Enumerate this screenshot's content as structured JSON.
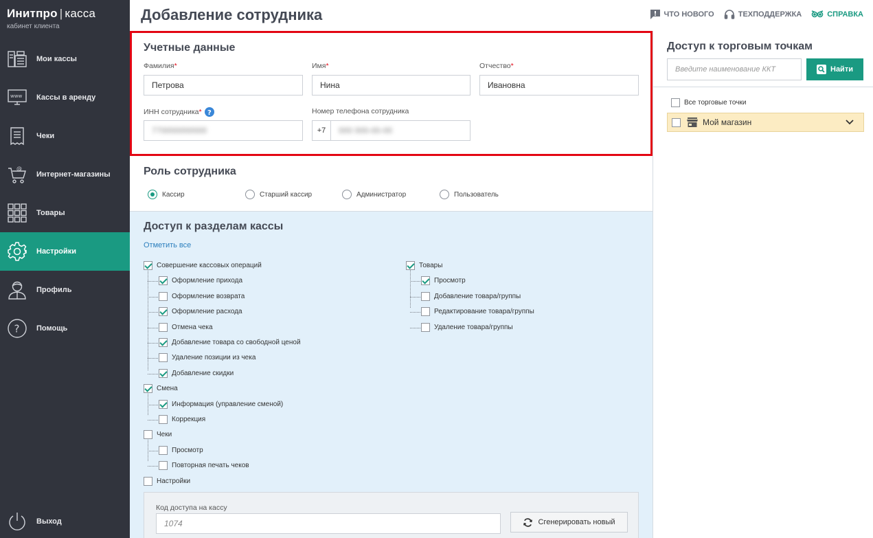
{
  "logo": {
    "brand": "Инитпро",
    "separator": "|",
    "product": "касса",
    "subtitle": "кабинет клиента"
  },
  "sidebar": {
    "items": [
      {
        "label": "Мои кассы",
        "icon": "cash-register-icon"
      },
      {
        "label": "Кассы в аренду",
        "icon": "www-monitor-icon"
      },
      {
        "label": "Чеки",
        "icon": "receipt-icon"
      },
      {
        "label": "Интернет-магазины",
        "icon": "cart-at-icon"
      },
      {
        "label": "Товары",
        "icon": "grid-icon"
      },
      {
        "label": "Настройки",
        "icon": "gear-icon",
        "active": true
      },
      {
        "label": "Профиль",
        "icon": "user-icon"
      },
      {
        "label": "Помощь",
        "icon": "question-icon"
      }
    ],
    "logout": "Выход"
  },
  "header": {
    "title": "Добавление сотрудника",
    "links": {
      "news": "ЧТО НОВОГО",
      "support": "ТЕХПОДДЕРЖКА",
      "help": "СПРАВКА"
    }
  },
  "credentials": {
    "title": "Учетные данные",
    "lastname": {
      "label": "Фамилия",
      "value": "Петрова"
    },
    "firstname": {
      "label": "Имя",
      "value": "Нина"
    },
    "middlename": {
      "label": "Отчество",
      "value": "Ивановна"
    },
    "inn": {
      "label": "ИНН сотрудника",
      "value": "770000000000"
    },
    "phone": {
      "label": "Номер телефона сотрудника",
      "prefix": "+7",
      "value": "000 000-00-00"
    },
    "required_mark": "*"
  },
  "role": {
    "title": "Роль сотрудника",
    "options": [
      "Кассир",
      "Старший кассир",
      "Администратор",
      "Пользователь"
    ],
    "selected": 0
  },
  "access": {
    "title": "Доступ к разделам кассы",
    "mark_all": "Отметить все",
    "left": [
      {
        "label": "Совершение кассовых операций",
        "checked": true,
        "level": 0
      },
      {
        "label": "Оформление прихода",
        "checked": true,
        "level": 1
      },
      {
        "label": "Оформление возврата",
        "checked": false,
        "level": 1
      },
      {
        "label": "Оформление расхода",
        "checked": true,
        "level": 1
      },
      {
        "label": "Отмена чека",
        "checked": false,
        "level": 1
      },
      {
        "label": "Добавление товара со свободной ценой",
        "checked": true,
        "level": 1
      },
      {
        "label": "Удаление позиции из чека",
        "checked": false,
        "level": 1
      },
      {
        "label": "Добавление скидки",
        "checked": true,
        "level": 1
      },
      {
        "label": "Смена",
        "checked": true,
        "level": 0
      },
      {
        "label": "Информация (управление сменой)",
        "checked": true,
        "level": 1
      },
      {
        "label": "Коррекция",
        "checked": false,
        "level": 1
      },
      {
        "label": "Чеки",
        "checked": false,
        "level": 0
      },
      {
        "label": "Просмотр",
        "checked": false,
        "level": 1
      },
      {
        "label": "Повторная печать чеков",
        "checked": false,
        "level": 1
      },
      {
        "label": "Настройки",
        "checked": false,
        "level": 0
      }
    ],
    "right": [
      {
        "label": "Товары",
        "checked": true,
        "level": 0
      },
      {
        "label": "Просмотр",
        "checked": true,
        "level": 1
      },
      {
        "label": "Добавление товара/группы",
        "checked": false,
        "level": 1
      },
      {
        "label": "Редактирование товара/группы",
        "checked": false,
        "level": 1
      },
      {
        "label": "Удаление товара/группы",
        "checked": false,
        "level": 1
      }
    ]
  },
  "access_code": {
    "label": "Код доступа на кассу",
    "value": "1074",
    "button": "Сгенерировать новый"
  },
  "outlets": {
    "title": "Доступ к торговым точкам",
    "search_placeholder": "Введите наименование ККТ",
    "find_button": "Найти",
    "all_label": "Все торговые точки",
    "shop": "Мой магазин"
  },
  "colors": {
    "accent": "#1a9a82",
    "sidebar": "#31343d",
    "highlight": "#e30613"
  }
}
